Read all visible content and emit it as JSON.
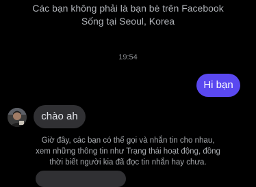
{
  "profile": {
    "friend_status": "Các bạn không phải là bạn bè trên Facebook",
    "location": "Sống tại Seoul, Korea"
  },
  "conversation": {
    "timestamp": "19:54",
    "messages": [
      {
        "sender": "me",
        "text": "Hi bạn"
      },
      {
        "sender": "them",
        "text": "chào ah"
      }
    ]
  },
  "notice": {
    "lines": [
      "Giờ đây, các bạn có thể gọi và nhắn tin cho nhau,",
      "xem những thông tin như Trạng thái hoạt động, đồng",
      "thời biết người kia đã đọc tin nhắn hay chưa."
    ]
  },
  "colors": {
    "background": "#000000",
    "outgoing_bubble": "#5a48f0",
    "incoming_bubble": "#303033"
  }
}
